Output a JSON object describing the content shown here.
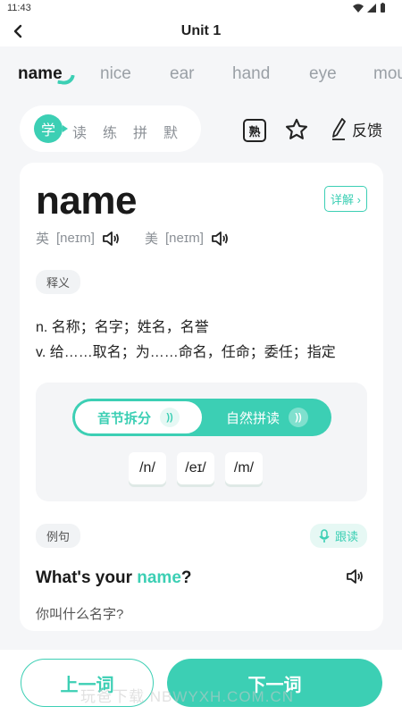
{
  "status_bar": {
    "time": "11:43"
  },
  "header": {
    "title": "Unit 1",
    "back_icon": "chevron-left-icon"
  },
  "word_tabs": [
    {
      "label": "name",
      "active": true
    },
    {
      "label": "nice",
      "active": false
    },
    {
      "label": "ear",
      "active": false
    },
    {
      "label": "hand",
      "active": false
    },
    {
      "label": "eye",
      "active": false
    },
    {
      "label": "mou",
      "active": false
    }
  ],
  "modes": {
    "learn": "学",
    "read": "读",
    "practice": "练",
    "spell": "拼",
    "dictate": "默"
  },
  "toolbar": {
    "familiar_label": "熟",
    "favorite_icon": "star-outline-icon",
    "feedback_label": "反馈"
  },
  "word": {
    "text": "name",
    "detail_label": "详解",
    "uk_label": "英",
    "uk_phonetic": "[neɪm]",
    "us_label": "美",
    "us_phonetic": "[neɪm]"
  },
  "definition": {
    "tag": "释义",
    "lines": [
      "n. 名称；名字；姓名，名誉",
      "v. 给……取名；为……命名，任命；委任；指定"
    ]
  },
  "phonics": {
    "syllable_tab": "音节拆分",
    "natural_tab": "自然拼读",
    "syllables": [
      "/n/",
      "/eɪ/",
      "/m/"
    ]
  },
  "example": {
    "tag": "例句",
    "follow_label": "跟读",
    "sentence_before": "What's your ",
    "sentence_highlight": "name",
    "sentence_after": "?",
    "translation": "你叫什么名字?"
  },
  "bottom": {
    "prev_label": "上一词",
    "next_label": "下一词"
  },
  "watermark": "玩爸下载 NBWYXH.COM.CN",
  "colors": {
    "accent": "#3ccfb4",
    "background": "#f5f6f8"
  }
}
